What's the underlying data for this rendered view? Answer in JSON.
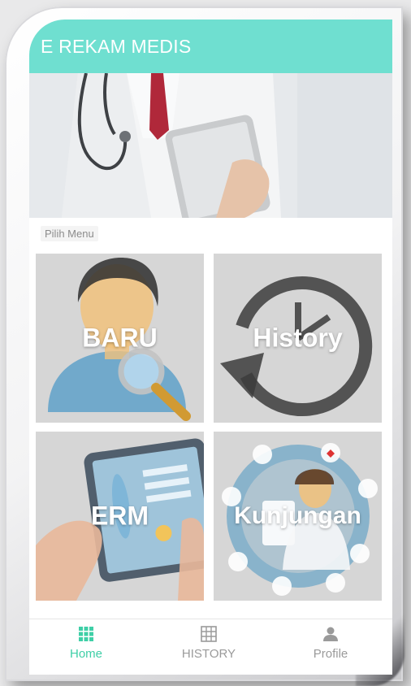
{
  "app": {
    "title": "E REKAM MEDIS"
  },
  "section": {
    "label": "Pilih Menu"
  },
  "menu": [
    {
      "id": "baru",
      "label": "BARU"
    },
    {
      "id": "history",
      "label": "History"
    },
    {
      "id": "erm",
      "label": "ERM"
    },
    {
      "id": "kunjungan",
      "label": "Kunjungan"
    }
  ],
  "bottom_nav": [
    {
      "label": "Home",
      "icon": "grid-icon",
      "active": true
    },
    {
      "label": "HISTORY",
      "icon": "calendar-grid-icon",
      "active": false
    },
    {
      "label": "Profile",
      "icon": "person-icon",
      "active": false
    }
  ],
  "colors": {
    "accent": "#6fdfd0",
    "nav_active": "#3fcfa7",
    "nav_inactive": "#9a9a9a"
  }
}
